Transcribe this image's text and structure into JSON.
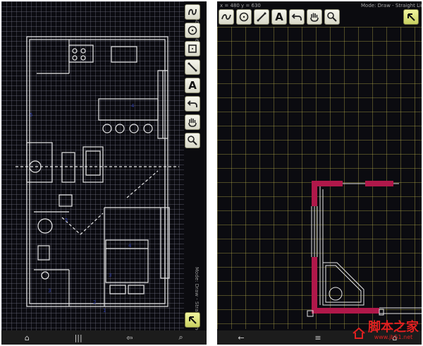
{
  "left_screen": {
    "coordinates": "x = 360 y = 360",
    "mode_label": "Mode: Draw - Straight Line",
    "tools": [
      {
        "icon": "freehand-icon"
      },
      {
        "icon": "circle-icon"
      },
      {
        "icon": "rectangle-icon"
      },
      {
        "icon": "line-icon"
      },
      {
        "icon": "text-tool-icon",
        "glyph": "A"
      },
      {
        "icon": "undo-icon"
      },
      {
        "icon": "pan-hand-icon"
      },
      {
        "icon": "zoom-icon"
      }
    ],
    "action_icon": "pointer-arrow-icon",
    "nav": [
      {
        "icon": "home-icon",
        "glyph": "⌂"
      },
      {
        "icon": "menu-icon",
        "glyph": "|||"
      },
      {
        "icon": "back-icon",
        "glyph": "⇦"
      },
      {
        "icon": "search-icon",
        "glyph": "⌕"
      }
    ]
  },
  "right_screen": {
    "coordinates": "x = 480 y = 630",
    "mode_label": "Mode: Draw - Straight Line",
    "tools": [
      {
        "icon": "freehand-icon"
      },
      {
        "icon": "circle-icon"
      },
      {
        "icon": "line-icon"
      },
      {
        "icon": "text-tool-icon",
        "glyph": "A"
      },
      {
        "icon": "undo-icon"
      },
      {
        "icon": "pan-hand-icon"
      },
      {
        "icon": "zoom-icon"
      }
    ],
    "action_icon": "pointer-arrow-icon",
    "nav": [
      {
        "icon": "back-icon",
        "glyph": "←"
      },
      {
        "icon": "menu-icon",
        "glyph": "≡"
      },
      {
        "icon": "home-icon",
        "glyph": "⌂"
      }
    ]
  },
  "watermark": {
    "main": "脚本之家",
    "sub": "www.jb51.net"
  },
  "colors": {
    "canvas_bg": "#0b0b10",
    "wall_accent": "#b0184a",
    "toolbar_btn": "#eeeedf",
    "action_btn": "#dde57a"
  }
}
